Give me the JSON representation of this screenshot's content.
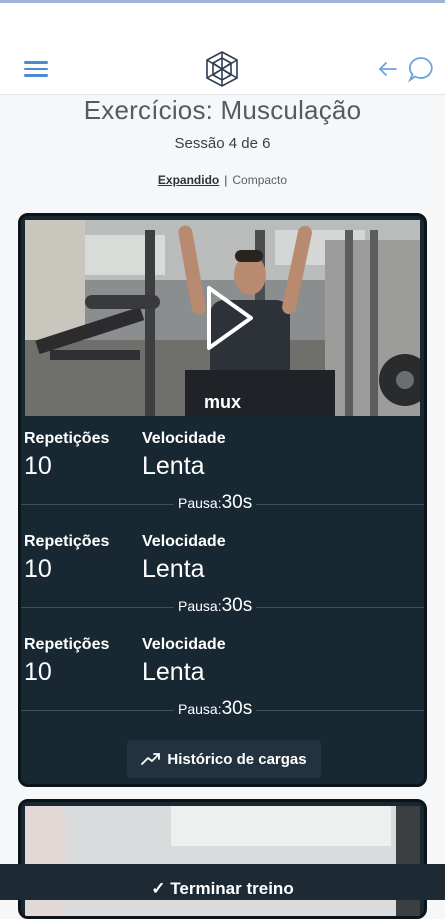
{
  "header": {
    "menu_icon": "hamburger-menu-icon",
    "logo_icon": "geodesic-logo-icon",
    "back_icon": "arrow-left-icon",
    "chat_icon": "chat-bubble-icon",
    "accent_color": "#4a8bd1"
  },
  "page": {
    "title": "Exercícios: Musculação",
    "session": "Sessão 4 de 6",
    "view_expanded": "Expandido",
    "view_separator": "|",
    "view_compact": "Compacto"
  },
  "exercise": {
    "video_label": "mux",
    "play_icon": "play-icon",
    "sets": [
      {
        "reps_label": "Repetições",
        "reps": "10",
        "speed_label": "Velocidade",
        "speed": "Lenta",
        "pause_label": "Pausa:",
        "pause": "30s"
      },
      {
        "reps_label": "Repetições",
        "reps": "10",
        "speed_label": "Velocidade",
        "speed": "Lenta",
        "pause_label": "Pausa:",
        "pause": "30s"
      },
      {
        "reps_label": "Repetições",
        "reps": "10",
        "speed_label": "Velocidade",
        "speed": "Lenta",
        "pause_label": "Pausa:",
        "pause": "30s"
      }
    ],
    "history_button": "Histórico de cargas",
    "history_icon": "trending-up-icon",
    "card_color": "#182833"
  },
  "footer": {
    "finish_button": "✓ Terminar treino"
  }
}
